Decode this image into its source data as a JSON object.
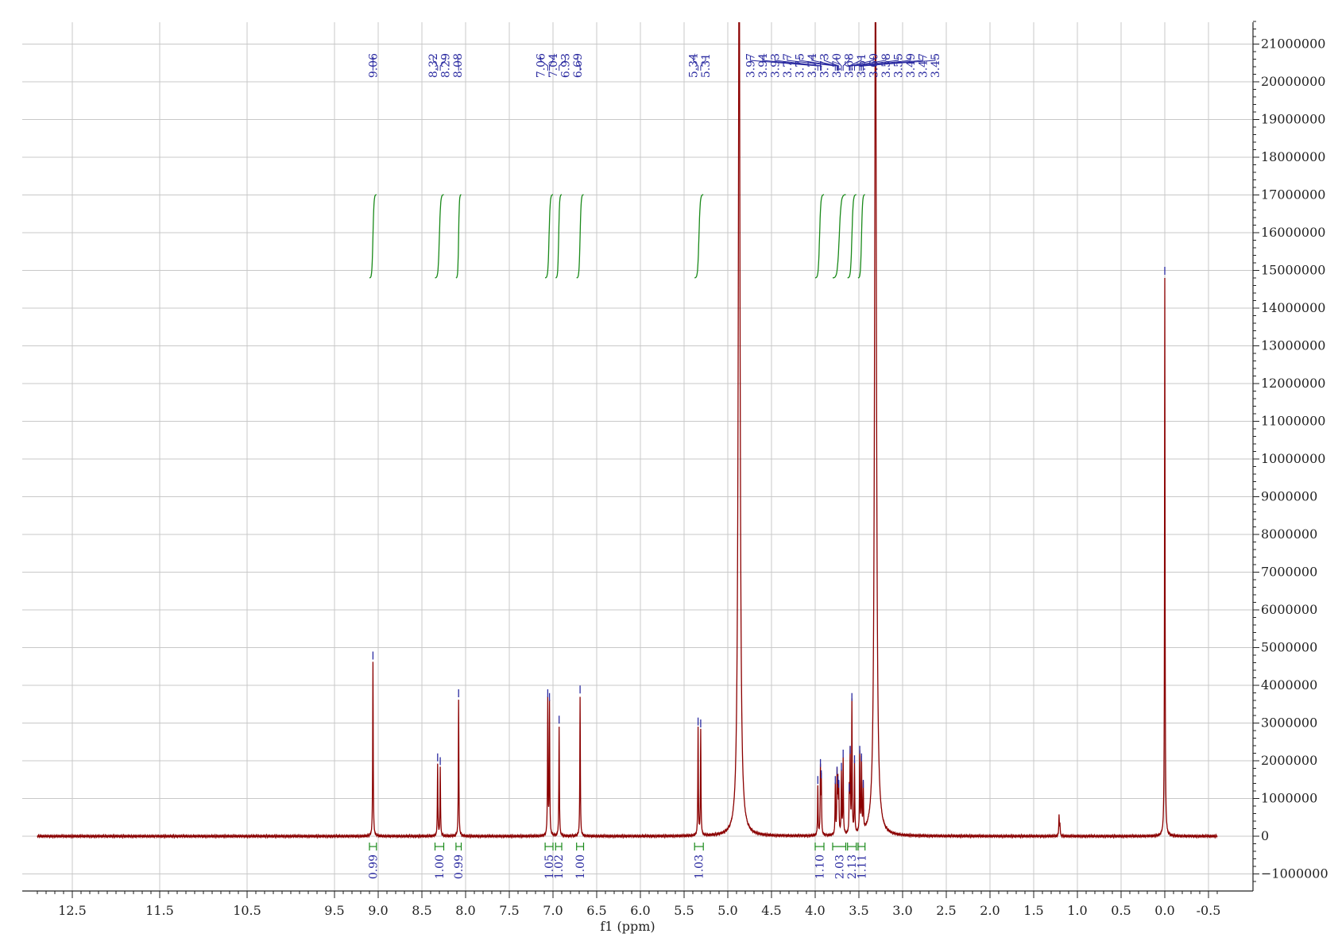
{
  "chart_data": {
    "type": "line",
    "title": "",
    "xlabel": "f1 (ppm)",
    "ylabel": "",
    "x_reversed": true,
    "xlim": [
      12.9,
      -0.6
    ],
    "ylim": [
      -1300000,
      21800000
    ],
    "grid": true,
    "x_tick_labels": [
      "12.5",
      "11.5",
      "10.5",
      "9.5",
      "9.0",
      "8.5",
      "8.0",
      "7.5",
      "7.0",
      "6.5",
      "6.0",
      "5.5",
      "5.0",
      "4.5",
      "4.0",
      "3.5",
      "3.0",
      "2.5",
      "2.0",
      "1.5",
      "1.0",
      "0.5",
      "0.0",
      "-0.5"
    ],
    "y_tick_labels": [
      "21000000",
      "20000000",
      "19000000",
      "18000000",
      "17000000",
      "16000000",
      "15000000",
      "14000000",
      "13000000",
      "12000000",
      "11000000",
      "10000000",
      "9000000",
      "8000000",
      "7000000",
      "6000000",
      "5000000",
      "4000000",
      "3000000",
      "2000000",
      "1000000",
      "0",
      "-1000000"
    ],
    "series": [
      {
        "peaks": [
          {
            "x": 9.06,
            "y": 4600000
          },
          {
            "x": 8.32,
            "y": 1900000
          },
          {
            "x": 8.29,
            "y": 1800000
          },
          {
            "x": 8.08,
            "y": 3600000
          },
          {
            "x": 7.06,
            "y": 3600000
          },
          {
            "x": 7.04,
            "y": 3500000
          },
          {
            "x": 6.93,
            "y": 2900000
          },
          {
            "x": 6.69,
            "y": 3700000
          },
          {
            "x": 5.34,
            "y": 2850000
          },
          {
            "x": 5.31,
            "y": 2800000
          },
          {
            "x": 4.87,
            "y": 24000000
          },
          {
            "x": 3.97,
            "y": 1300000
          },
          {
            "x": 3.94,
            "y": 1750000
          },
          {
            "x": 3.93,
            "y": 1450000
          },
          {
            "x": 3.77,
            "y": 1300000
          },
          {
            "x": 3.75,
            "y": 1550000
          },
          {
            "x": 3.74,
            "y": 1300000
          },
          {
            "x": 3.73,
            "y": 1200000
          },
          {
            "x": 3.7,
            "y": 1650000
          },
          {
            "x": 3.68,
            "y": 2000000
          },
          {
            "x": 3.61,
            "y": 1100000
          },
          {
            "x": 3.6,
            "y": 2100000
          },
          {
            "x": 3.58,
            "y": 3500000
          },
          {
            "x": 3.55,
            "y": 1850000
          },
          {
            "x": 3.49,
            "y": 2100000
          },
          {
            "x": 3.47,
            "y": 1900000
          },
          {
            "x": 3.45,
            "y": 1200000
          },
          {
            "x": 3.31,
            "y": 24000000
          },
          {
            "x": 1.21,
            "y": 550000
          },
          {
            "x": 1.2,
            "y": 300000
          },
          {
            "x": 0.0,
            "y": 14800000
          }
        ]
      }
    ],
    "peak_labels": [
      {
        "group": [
          "9.06"
        ]
      },
      {
        "group": [
          "8.32",
          "8.29",
          "8.08"
        ]
      },
      {
        "group": [
          "7.06",
          "7.04",
          "6.93",
          "6.69"
        ]
      },
      {
        "group": [
          "5.34",
          "5.31"
        ]
      },
      {
        "group": [
          "3.97",
          "3.94",
          "3.93",
          "3.77",
          "3.75",
          "3.74",
          "3.73",
          "3.70",
          "3.68",
          "3.61",
          "3.60",
          "3.58",
          "3.55",
          "3.49",
          "3.47",
          "3.45"
        ]
      }
    ],
    "integrals": [
      {
        "from": 9.1,
        "to": 9.02,
        "value": "0.99"
      },
      {
        "from": 8.35,
        "to": 8.25,
        "value": "1.00"
      },
      {
        "from": 8.11,
        "to": 8.05,
        "value": "0.99"
      },
      {
        "from": 7.09,
        "to": 7.0,
        "value": "1.05"
      },
      {
        "from": 6.97,
        "to": 6.9,
        "value": "1.02"
      },
      {
        "from": 6.73,
        "to": 6.65,
        "value": "1.00"
      },
      {
        "from": 5.38,
        "to": 5.28,
        "value": "1.03"
      },
      {
        "from": 4.0,
        "to": 3.9,
        "value": "1.10"
      },
      {
        "from": 3.8,
        "to": 3.65,
        "value": "2.03"
      },
      {
        "from": 3.63,
        "to": 3.53,
        "value": "2.13"
      },
      {
        "from": 3.51,
        "to": 3.43,
        "value": "1.11"
      }
    ],
    "colors": {
      "spectrum": "#8b0000",
      "peak_label": "#2a2aa0",
      "integral": "#1a8a1a",
      "grid": "#c8c8c8",
      "axis": "#222222"
    }
  }
}
